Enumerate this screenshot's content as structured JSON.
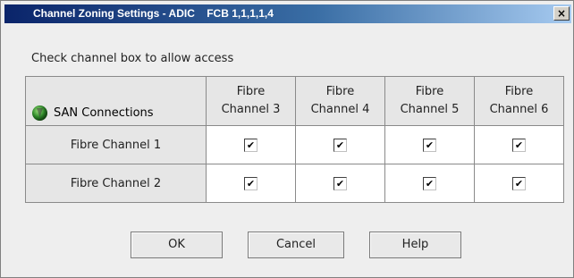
{
  "window": {
    "title": "Channel Zoning Settings - ADIC    FCB 1,1,1,1,4",
    "close_glyph": "×"
  },
  "instruction": "Check channel box to allow access",
  "matrix": {
    "corner_icon": "globe-icon",
    "corner_label": "SAN Connections",
    "columns": [
      {
        "line1": "Fibre",
        "line2": "Channel 3"
      },
      {
        "line1": "Fibre",
        "line2": "Channel 4"
      },
      {
        "line1": "Fibre",
        "line2": "Channel 5"
      },
      {
        "line1": "Fibre",
        "line2": "Channel 6"
      }
    ],
    "rows": [
      {
        "label": "Fibre Channel 1",
        "checks": [
          "✔",
          "✔",
          "✔",
          "✔"
        ]
      },
      {
        "label": "Fibre Channel 2",
        "checks": [
          "✔",
          "✔",
          "✔",
          "✔"
        ]
      }
    ]
  },
  "buttons": {
    "ok": "OK",
    "cancel": "Cancel",
    "help": "Help"
  }
}
